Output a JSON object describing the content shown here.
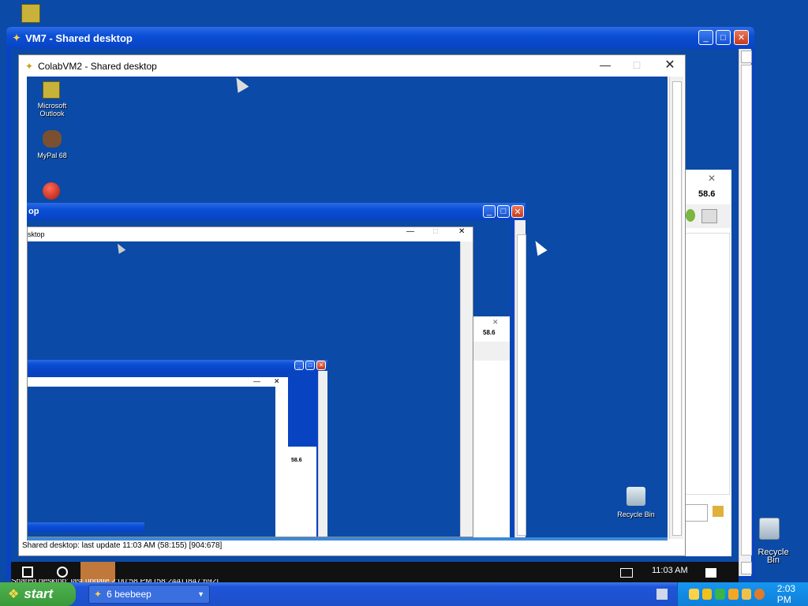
{
  "desktop": {
    "top_icon": "outlook-icon",
    "recycle_bin_label": "Recycle Bin"
  },
  "vm7_window": {
    "title": "VM7 - Shared desktop",
    "icon": "colab-icon",
    "buttons": {
      "min": "_",
      "max": "□",
      "close": "✕"
    }
  },
  "colab_window": {
    "title": "ColabVM2 - Shared desktop",
    "status": "Shared desktop: last update 11:03 AM (58:155) [904:678]",
    "icons": [
      {
        "label": "Microsoft Outlook",
        "icon": "outlook-icon"
      },
      {
        "label": "MyPal 68",
        "icon": "mypal-icon"
      },
      {
        "label": "",
        "icon": "red-ball-icon"
      },
      {
        "label": "Recycle Bin",
        "icon": "recycle-bin-icon"
      }
    ]
  },
  "nested": {
    "xp_title_fragment": "op",
    "w10_title_fragment": "sktop",
    "side_number": "58.6",
    "side_number_small": "58.6"
  },
  "inner_taskbar": {
    "clock": "11:03 AM",
    "status_under": "Shared desktop: last update 2:00:58 PM (58:244) [847:692]"
  },
  "taskbar": {
    "start_label": "start",
    "task_label": "6 beebeep",
    "clock": "2:03 PM"
  },
  "colors": {
    "desktop": "#0b4aa6",
    "taskbar": "#1f55d8",
    "start": "#3a9a3a"
  }
}
